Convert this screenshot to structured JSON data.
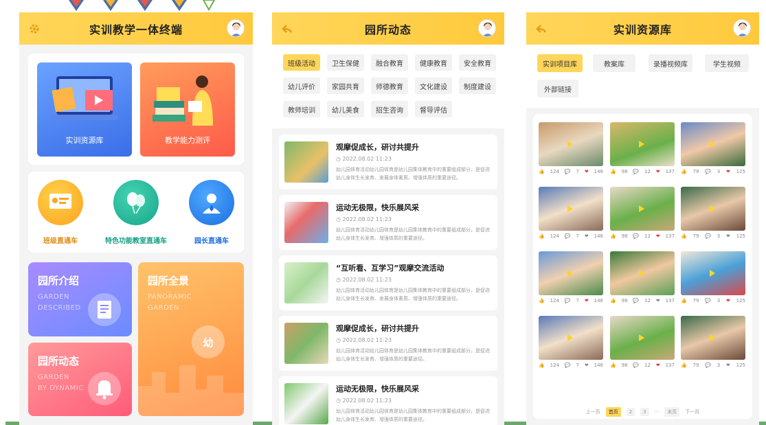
{
  "colors": {
    "accent": "#ffd65a",
    "brand": "#ffc93c",
    "blue_tile": "#5b8ff9",
    "orange_tile": "#ff7a45",
    "like": "#f0a020",
    "heart": "#e53935"
  },
  "screen1": {
    "title": "实训教学一体终端",
    "tiles": [
      "实训资源库",
      "教学能力测评"
    ],
    "shortcuts": [
      "班级直通车",
      "特色功能教室直通车",
      "园长直通车"
    ],
    "cards": [
      {
        "title": "园所介绍",
        "sub1": "GARDEN",
        "sub2": "DESCRIBED"
      },
      {
        "title": "园所全景",
        "sub1": "PANORAMIC",
        "sub2": "GARDEN"
      },
      {
        "title": "园所动态",
        "sub1": "GARDEN",
        "sub2": "BY DYNAMIC"
      }
    ],
    "badge": "幼"
  },
  "screen2": {
    "title": "园所动态",
    "categories": [
      "班级活动",
      "卫生保健",
      "融合教育",
      "健康教育",
      "安全教育",
      "幼儿评价",
      "家园共育",
      "师德教育",
      "文化建设",
      "制度建设",
      "教师培训",
      "幼儿美食",
      "招生咨询",
      "督导评估"
    ],
    "news": [
      {
        "title": "观摩促成长，研讨共提升",
        "date": "2022.08.02 11:23",
        "text": "幼儿园体育活动幼儿园体育是幼儿园集体教育中的重要组成部分，是促进幼儿身体生长发育、发展身体素质、增强体质的重要途径。"
      },
      {
        "title": "运动无极限，快乐展风采",
        "date": "2022.08.02 11:23",
        "text": "幼儿园体育活动幼儿园体育是幼儿园集体教育中的重要组成部分，是促进幼儿身体生长发育、增强体质的重要途径。"
      },
      {
        "title": "“互听看、互学习”观摩交流活动",
        "date": "2022.08.02 11:23",
        "text": "幼儿园体育活动幼儿园体育是幼儿园集体教育中的重要组成部分，是促进幼儿身体生长发育、发展身体素质、增强体质的重要途径。"
      },
      {
        "title": "观摩促成长，研讨共提升",
        "date": "2022.08.02 11:23",
        "text": "幼儿园体育活动幼儿园体育是幼儿园集体教育中的重要组成部分，是促进幼儿身体生长发育、增强体质的重要途径。"
      },
      {
        "title": "运动无极限，快乐展风采",
        "date": "2022.08.02 11:23",
        "text": "幼儿园体育活动幼儿园体育是幼儿园集体教育中的重要组成部分，是促进幼儿身体生长发育、增强体质的重要途径。"
      }
    ]
  },
  "screen3": {
    "title": "实训资源库",
    "tabs": [
      "实训项目库",
      "教案库",
      "录播视频库",
      "学生视频",
      "外部链接"
    ],
    "stats": [
      [
        "124",
        "7",
        "146"
      ],
      [
        "98",
        "12",
        "137"
      ],
      [
        "79",
        "3",
        "125"
      ]
    ],
    "pager": [
      "上一页",
      "首页",
      "2",
      "3",
      "···",
      "末页",
      "下一页"
    ]
  }
}
